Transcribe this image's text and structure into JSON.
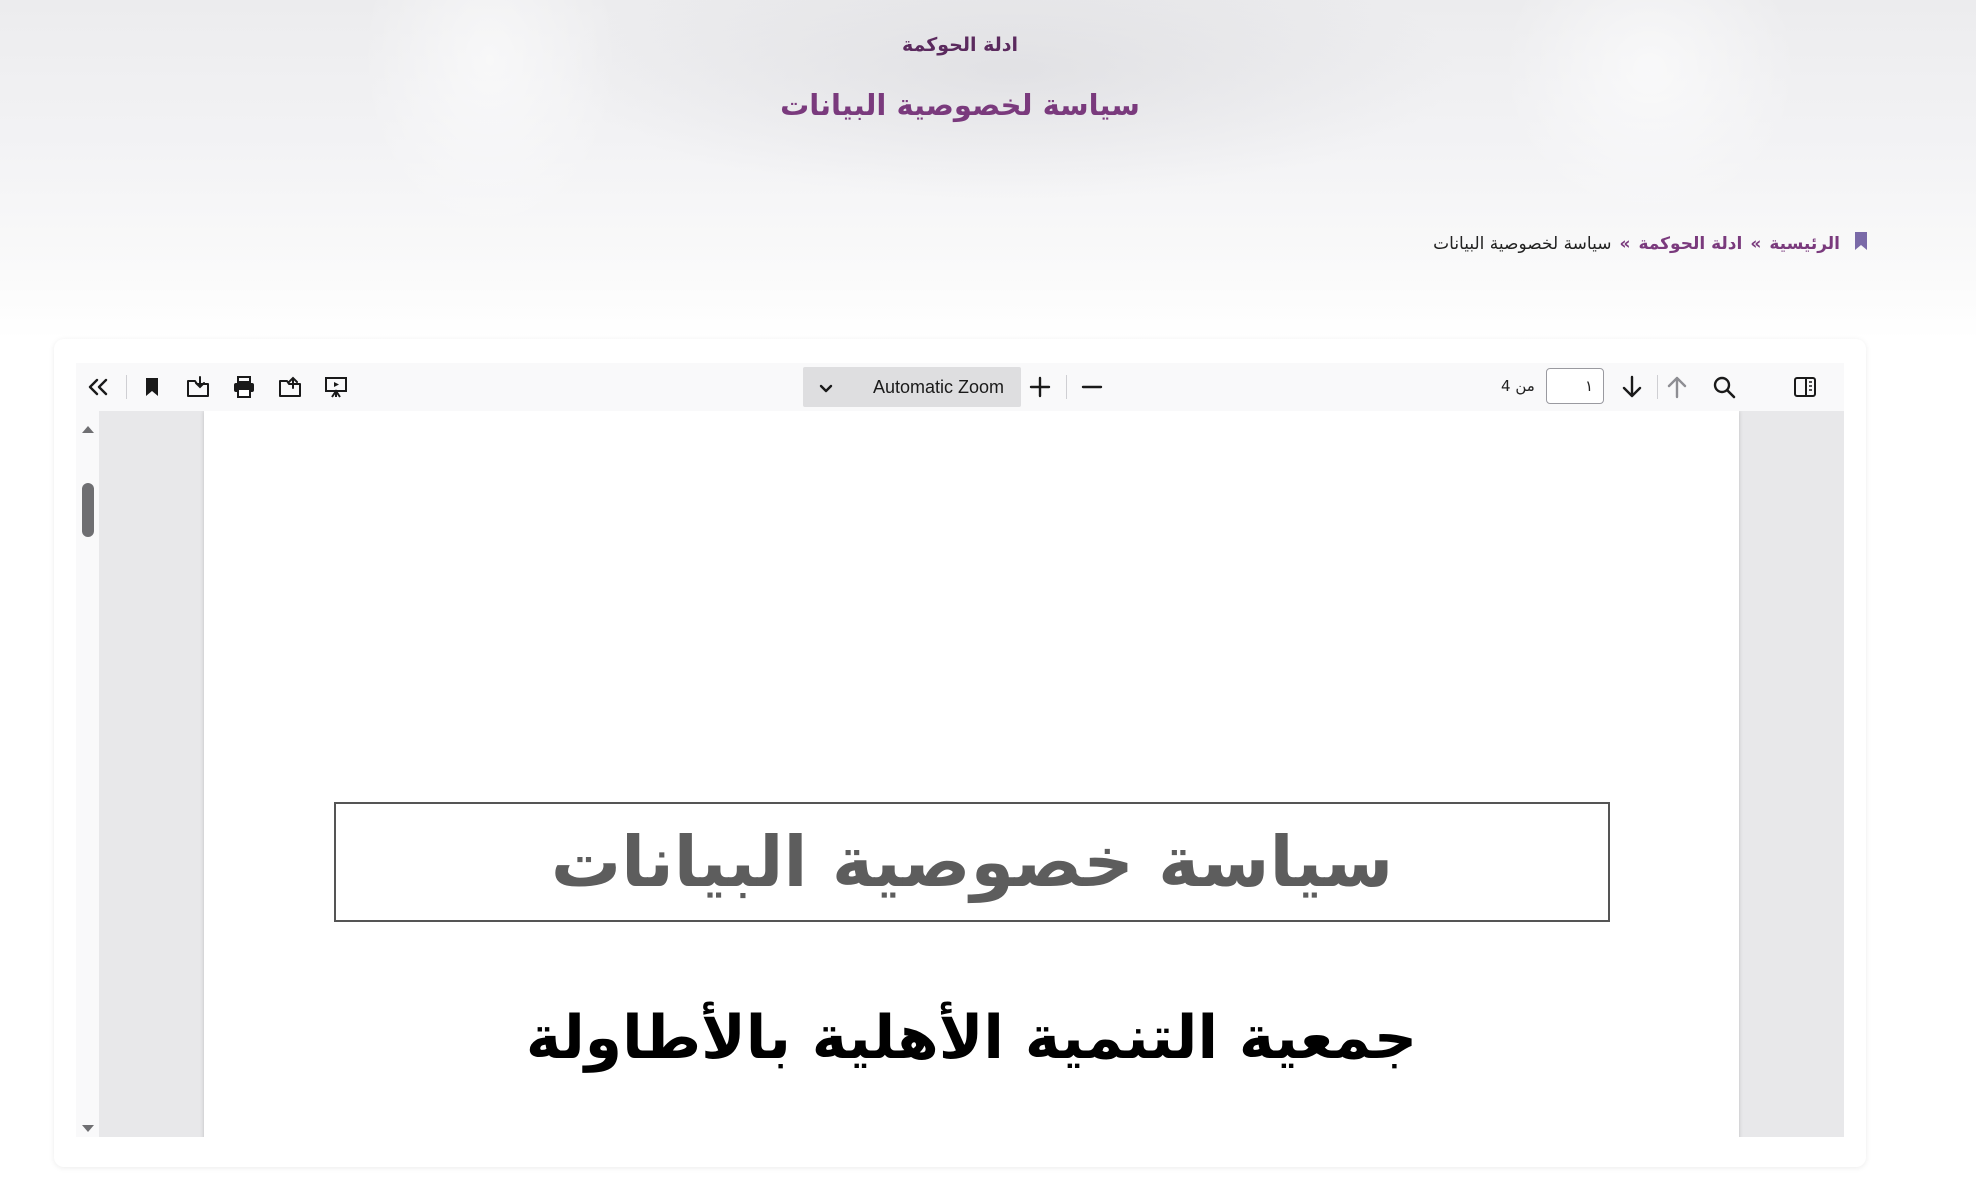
{
  "hero": {
    "subtitle": "ادلة الحوكمة",
    "title": "سياسة لخصوصية البيانات"
  },
  "breadcrumb": {
    "icon": "bookmark-icon",
    "home": "الرئيسية",
    "separator": "»",
    "section": "ادلة الحوكمة",
    "current": "سياسة لخصوصية البيانات"
  },
  "toolbar": {
    "zoom_label": "Automatic Zoom",
    "page_current": "١",
    "page_count_text": "من 4",
    "icons": {
      "sidebar": "sidebar-toggle-icon",
      "search": "search-icon",
      "prev": "arrow-up-icon",
      "next": "arrow-down-icon",
      "zoom_out": "minus-icon",
      "zoom_in": "plus-icon",
      "presentation": "presentation-icon",
      "open": "open-file-icon",
      "print": "print-icon",
      "download": "download-icon",
      "bookmark": "bookmark-icon",
      "tools": "double-chevron-left-icon"
    }
  },
  "document": {
    "title": "سياسة خصوصية البيانات",
    "organization": "جمعية التنمية الأهلية بالأطاولة"
  },
  "colors": {
    "accent": "#7a3a7d",
    "accent_dark": "#5b2a5e",
    "text": "#222222"
  }
}
